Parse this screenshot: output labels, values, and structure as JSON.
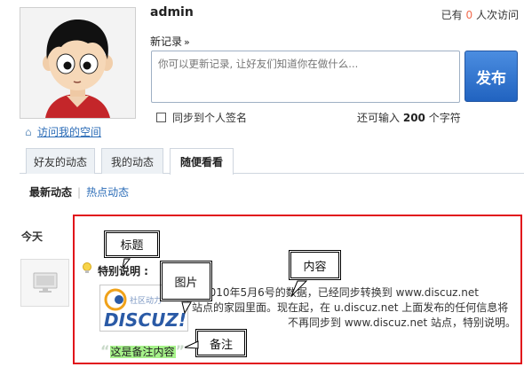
{
  "profile": {
    "username": "admin",
    "visits_prefix": "已有",
    "visits_count": "0",
    "visits_suffix": "人次访问",
    "visit_space_link": "访问我的空间"
  },
  "composer": {
    "title": "新记录",
    "title_arrow": "»",
    "placeholder": "你可以更新记录, 让好友们知道你在做什么...",
    "publish_label": "发布",
    "sync_label": "同步到个人签名",
    "remain_prefix": "还可输入",
    "remain_count": "200",
    "remain_suffix": "个字符"
  },
  "tabs": [
    {
      "label": "好友的动态",
      "active": false
    },
    {
      "label": "我的动态",
      "active": false
    },
    {
      "label": "随便看看",
      "active": true
    }
  ],
  "subnav": {
    "current": "最新动态",
    "separator": "|",
    "other": "热点动态"
  },
  "feed": {
    "day_label": "今天",
    "item": {
      "title": "特别说明 :",
      "image_alt": "社区动力 DISCUZ!",
      "content_lines": [
        "到2010年5月6号的数据，已经同步转换到 www.discuz.net",
        "站点的家园里面。现在起，在 u.discuz.net 上面发布的任何信息将",
        "不再同步到 www.discuz.net 站点，特别说明。"
      ],
      "remark": "这是备注内容"
    }
  },
  "annotations": {
    "title": "标题",
    "image": "图片",
    "content": "内容",
    "remark": "备注"
  },
  "colors": {
    "accent_blue": "#2163c0",
    "link": "#2b6cb7",
    "annotation_frame": "#e1121b",
    "remark_highlight": "#a6f28a",
    "visit_count": "#f26c4f"
  },
  "icons": {
    "home": "home-icon",
    "bulb": "lightbulb-icon",
    "checkbox": "checkbox-icon",
    "placeholder_avatar": "monitor-icon"
  }
}
